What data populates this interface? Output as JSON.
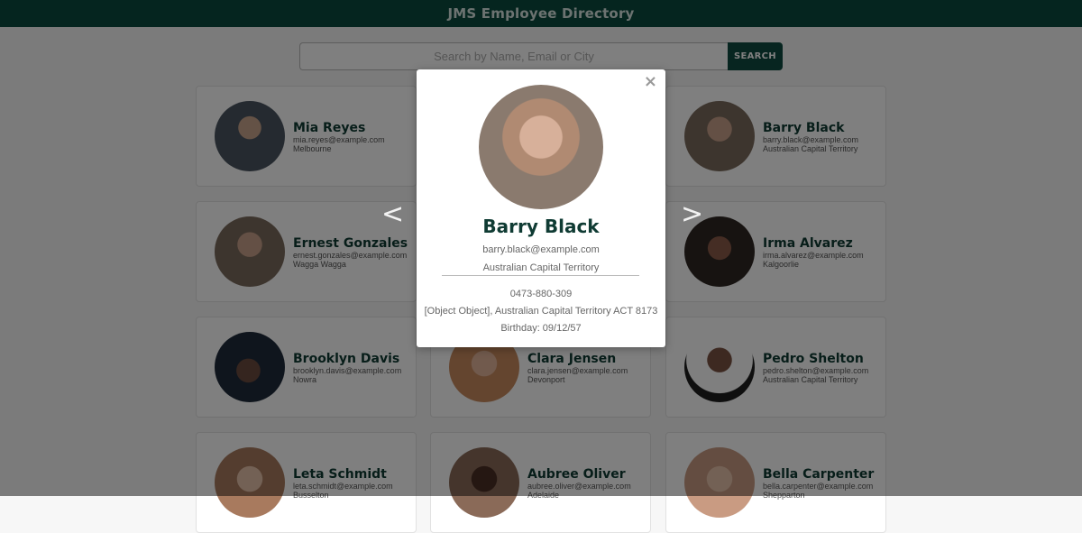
{
  "header": {
    "title": "JMS Employee Directory"
  },
  "search": {
    "placeholder": "Search by Name, Email or City",
    "button_label": "SEARCH"
  },
  "employees": [
    {
      "name": "Mia Reyes",
      "email": "mia.reyes@example.com",
      "city": "Melbourne",
      "avatar_color": "#4a5560"
    },
    {
      "name": "",
      "email": "",
      "city": "",
      "avatar_color": "#cccccc"
    },
    {
      "name": "Barry Black",
      "email": "barry.black@example.com",
      "city": "Australian Capital Territory",
      "avatar_color": "#b89a86"
    },
    {
      "name": "Ernest Gonzales",
      "email": "ernest.gonzales@example.com",
      "city": "Wagga Wagga",
      "avatar_color": "#b89a86"
    },
    {
      "name": "",
      "email": "",
      "city": "",
      "avatar_color": "#cccccc"
    },
    {
      "name": "Irma Alvarez",
      "email": "irma.alvarez@example.com",
      "city": "Kalgoorlie",
      "avatar_color": "#4a3c36"
    },
    {
      "name": "Brooklyn Davis",
      "email": "brooklyn.davis@example.com",
      "city": "Nowra",
      "avatar_color": "#3a4a5e"
    },
    {
      "name": "Clara Jensen",
      "email": "clara.jensen@example.com",
      "city": "Devonport",
      "avatar_color": "#d9a48a"
    },
    {
      "name": "Pedro Shelton",
      "email": "pedro.shelton@example.com",
      "city": "Australian Capital Territory",
      "avatar_color": "#6b4a3a"
    },
    {
      "name": "Leta Schmidt",
      "email": "leta.schmidt@example.com",
      "city": "Busselton",
      "avatar_color": "#c7a38a"
    },
    {
      "name": "Aubree Oliver",
      "email": "aubree.oliver@example.com",
      "city": "Adelaide",
      "avatar_color": "#5a3a2e"
    },
    {
      "name": "Bella Carpenter",
      "email": "bella.carpenter@example.com",
      "city": "Shepparton",
      "avatar_color": "#c99b82"
    }
  ],
  "modal": {
    "name": "Barry Black",
    "email": "barry.black@example.com",
    "city": "Australian Capital Territory",
    "phone": "0473-880-309",
    "address": "[Object Object], Australian Capital Territory ACT 8173",
    "birthday": "Birthday: 09/12/57",
    "close_icon": "×",
    "prev_label": "<",
    "next_label": ">",
    "photo_color": "#b89a86"
  },
  "colors": {
    "header_bg": "#0b4a3f",
    "accent": "#0e4a40",
    "name_text": "#0f3b33"
  }
}
